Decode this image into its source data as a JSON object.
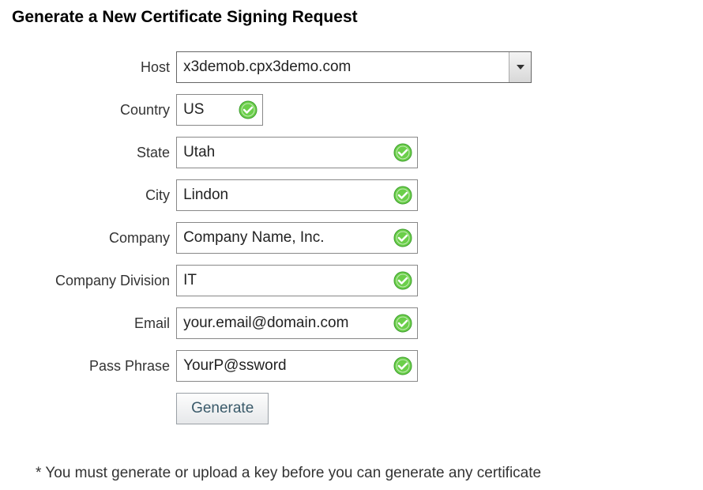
{
  "title": "Generate a New Certificate Signing Request",
  "form": {
    "host_label": "Host",
    "host_value": "x3demob.cpx3demo.com",
    "country_label": "Country",
    "country_value": "US",
    "state_label": "State",
    "state_value": "Utah",
    "city_label": "City",
    "city_value": "Lindon",
    "company_label": "Company",
    "company_value": "Company Name, Inc.",
    "division_label": "Company Division",
    "division_value": "IT",
    "email_label": "Email",
    "email_value": "your.email@domain.com",
    "passphrase_label": "Pass Phrase",
    "passphrase_value": "YourP@ssword",
    "generate_button": "Generate"
  },
  "footnote": "* You must generate or upload a key before you can generate any certificate"
}
